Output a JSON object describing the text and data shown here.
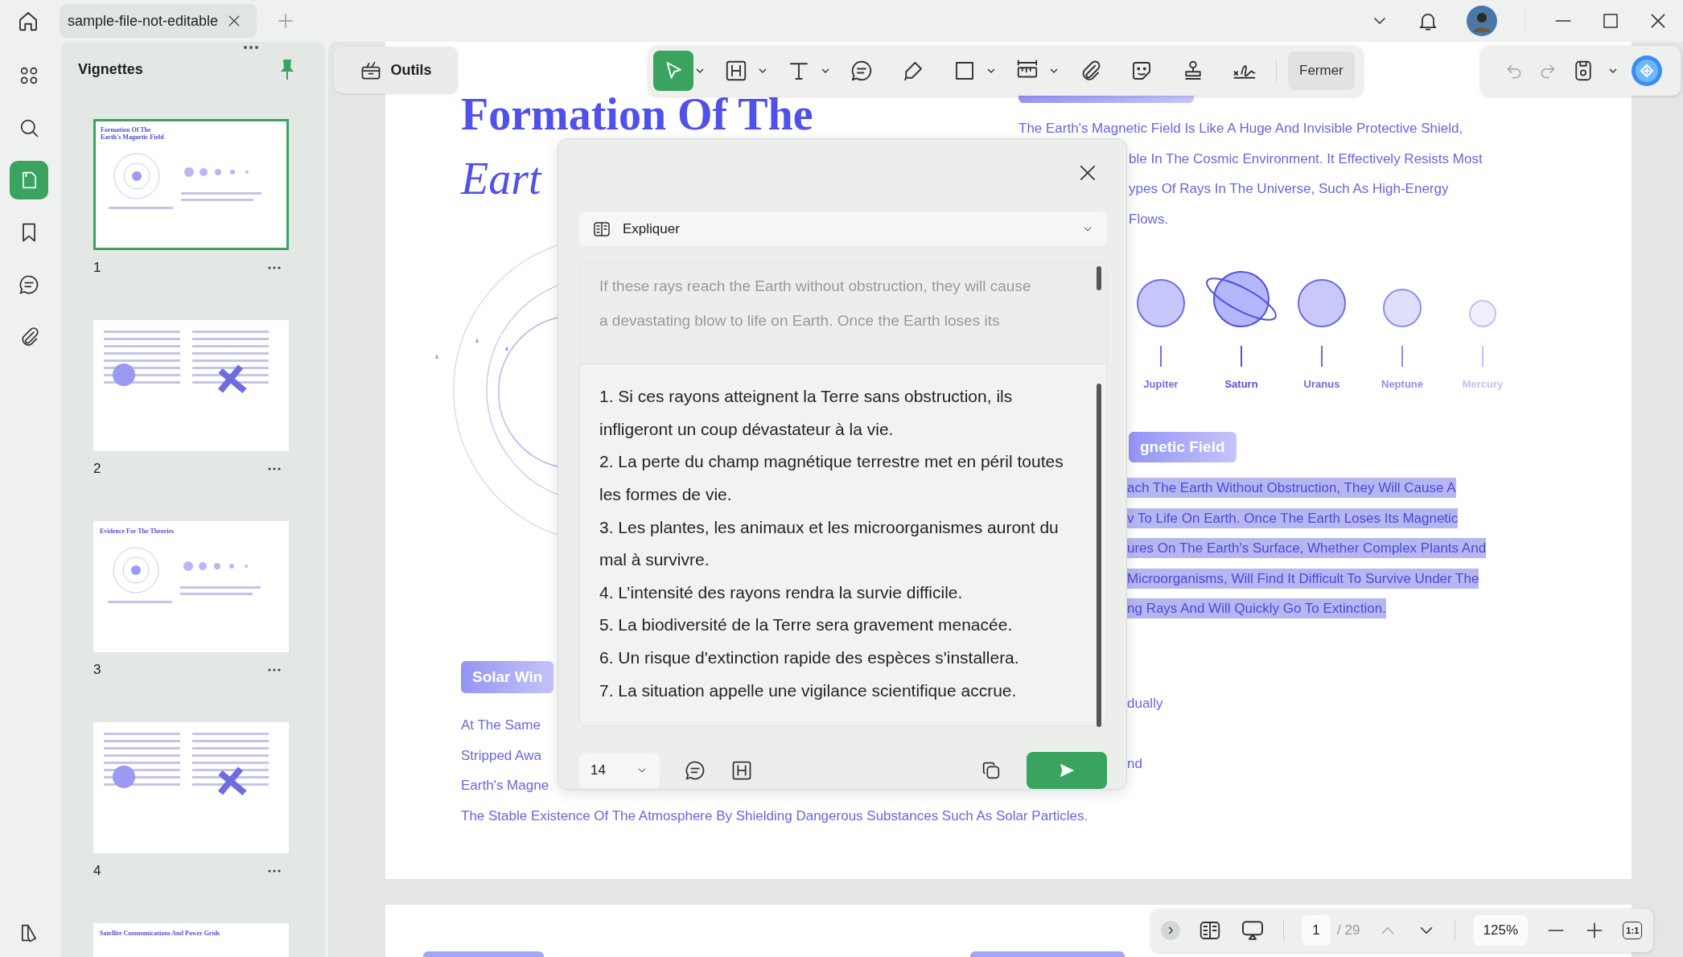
{
  "top_bar": {
    "tabs": [
      {
        "label": "sample-file-not-editable",
        "selected": true
      }
    ]
  },
  "rail": [
    {
      "kind": "grid",
      "selected": false
    },
    {
      "kind": "search",
      "selected": false
    },
    {
      "kind": "pages",
      "selected": true
    },
    {
      "kind": "bookmark",
      "selected": false
    },
    {
      "kind": "comment",
      "selected": false
    },
    {
      "kind": "attachment",
      "selected": false
    }
  ],
  "thumbnails_panel": {
    "title": "Vignettes",
    "pages": [
      {
        "label": "1",
        "selected": true,
        "title_lines": [
          "Formation Of The",
          "Earth's Magnetic Field"
        ]
      },
      {
        "label": "2",
        "selected": false
      },
      {
        "label": "3",
        "selected": false,
        "title_lines": [
          "Evidence For The Theories"
        ]
      },
      {
        "label": "4",
        "selected": false
      },
      {
        "selected": false,
        "title_lines": [
          "Satellite Communications And Power Grids"
        ]
      }
    ]
  },
  "tools_button": "Outils",
  "toolbar": {
    "tools": [
      {
        "kind": "select",
        "selected": true,
        "menu": true
      },
      {
        "kind": "heading",
        "selected": false,
        "menu": true
      },
      {
        "kind": "text",
        "selected": false,
        "menu": true
      },
      {
        "kind": "comment",
        "selected": false,
        "menu": false
      },
      {
        "kind": "pen",
        "selected": false,
        "menu": false
      },
      {
        "kind": "rectangle",
        "selected": false,
        "menu": true
      },
      {
        "kind": "ruler",
        "selected": false,
        "menu": true
      },
      {
        "kind": "attachment",
        "selected": false,
        "menu": false
      },
      {
        "kind": "sticker",
        "selected": false,
        "menu": false
      },
      {
        "kind": "stamp",
        "selected": false,
        "menu": false
      },
      {
        "kind": "signature",
        "selected": false,
        "menu": false
      }
    ],
    "close_button": "Fermer"
  },
  "quick_actions": [
    {
      "kind": "undo",
      "disabled": true
    },
    {
      "kind": "redo",
      "disabled": true
    },
    {
      "kind": "save",
      "disabled": false
    }
  ],
  "document": {
    "title": "Formation Of The",
    "subtitle": "Eart",
    "left_section": {
      "heading": "Solar Win",
      "lines": [
        "At The Same",
        "Stripped Awa",
        "Earth's Magne",
        "The Stable Existence Of The Atmosphere By Shielding Dangerous Substances Such As Solar Particles."
      ]
    },
    "right_lines": [
      {
        "text": "The Earth's Magnetic Field Is Like A Huge And Invisible Protective Shield,",
        "cut": false
      },
      {
        "text": "ble In The Cosmic Environment. It Effectively Resists Most",
        "cut": true
      },
      {
        "text": "ypes Of Rays In The Universe, Such As High-Energy",
        "cut": true
      },
      {
        "text": "Flows.",
        "cut": true
      }
    ],
    "planets": [
      {
        "name": "Jupiter",
        "kind": "plain",
        "color": "#c6c6fa"
      },
      {
        "name": "Saturn",
        "kind": "ringed",
        "color": "#b5b5fa"
      },
      {
        "name": "Uranus",
        "kind": "plain",
        "color": "#c8c8fa"
      },
      {
        "name": "Neptune",
        "kind": "plain",
        "color": "#dfdffc"
      },
      {
        "name": "Mercury",
        "kind": "plain",
        "color": "#efeffd"
      }
    ],
    "heading_2": "gnetic Field",
    "highlighted_lines": [
      "ach The Earth Without Obstruction, They Will Cause A",
      "v To Life On Earth. Once The Earth Loses Its Magnetic",
      "ures On The Earth's Surface, Whether Complex Plants And",
      "Microorganisms, Will Find It Difficult To Survive Under The",
      "ng Rays And Will Quickly Go To Extinction."
    ],
    "trailing_lines": [
      "dually",
      "nd"
    ]
  },
  "dialog": {
    "mode": "Expliquer",
    "source_lines": [
      "If these rays reach the Earth without obstruction, they will cause",
      "a devastating blow to life on Earth. Once the Earth loses its"
    ],
    "result": [
      "1. Si ces rayons atteignent la Terre sans obstruction, ils infligeront un coup dévastateur à la vie.",
      "2. La perte du champ magnétique terrestre met en péril toutes les formes de vie.",
      "3. Les plantes, les animaux et les microorganismes auront du mal à survivre.",
      "4. L’intensité des rayons rendra la survie difficile.",
      "5. La biodiversité de la Terre sera gravement menacée.",
      "6. Un risque d'extinction rapide des espèces s'installera.",
      "7. La situation appelle une vigilance scientifique accrue."
    ],
    "font_size": "14"
  },
  "bottom_bar": {
    "page": "1",
    "page_count": "/ 29",
    "zoom": "125%",
    "actual_size": "1:1"
  }
}
